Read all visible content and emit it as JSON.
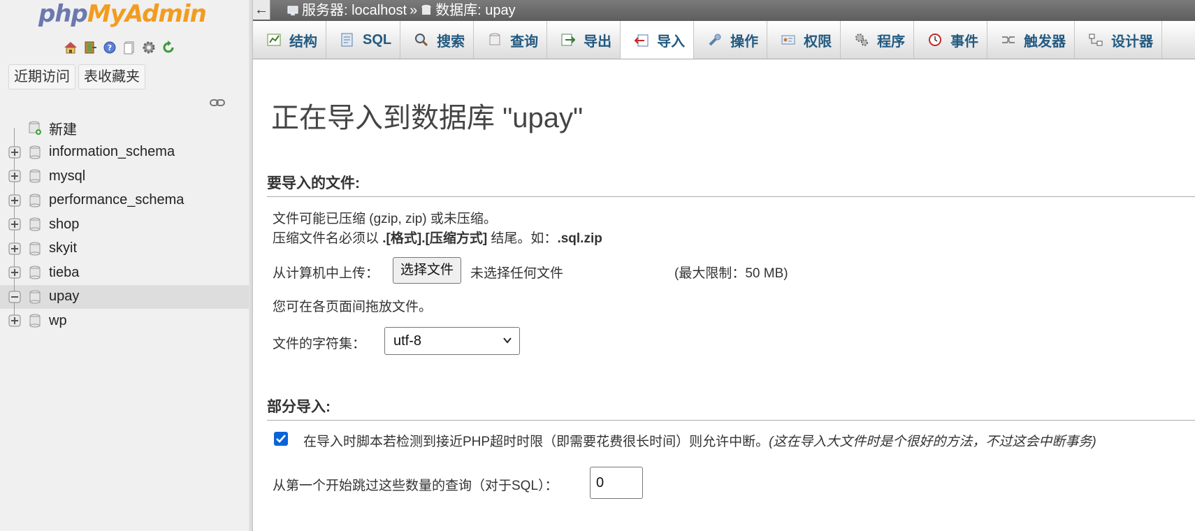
{
  "logo": {
    "php": "php",
    "my": "My",
    "admin": "Admin"
  },
  "quick_icons": [
    "home-icon",
    "exit-icon",
    "help-icon",
    "docs-icon",
    "gear-icon",
    "reload-icon"
  ],
  "recent": {
    "recent_label": "近期访问",
    "favorites_label": "表收藏夹"
  },
  "tree": {
    "new_label": "新建",
    "databases": [
      {
        "name": "information_schema",
        "active": false
      },
      {
        "name": "mysql",
        "active": false
      },
      {
        "name": "performance_schema",
        "active": false
      },
      {
        "name": "shop",
        "active": false
      },
      {
        "name": "skyit",
        "active": false
      },
      {
        "name": "tieba",
        "active": false
      },
      {
        "name": "upay",
        "active": true
      },
      {
        "name": "wp",
        "active": false
      }
    ]
  },
  "breadcrumb": {
    "back": "←",
    "server": "服务器: localhost",
    "sep": "»",
    "database": "数据库: upay"
  },
  "tabs": [
    {
      "label": "结构",
      "icon": "structure-icon",
      "active": false
    },
    {
      "label": "SQL",
      "icon": "sql-icon",
      "active": false
    },
    {
      "label": "搜索",
      "icon": "search-icon",
      "active": false
    },
    {
      "label": "查询",
      "icon": "query-icon",
      "active": false
    },
    {
      "label": "导出",
      "icon": "export-icon",
      "active": false
    },
    {
      "label": "导入",
      "icon": "import-icon",
      "active": true
    },
    {
      "label": "操作",
      "icon": "wrench-icon",
      "active": false
    },
    {
      "label": "权限",
      "icon": "privileges-icon",
      "active": false
    },
    {
      "label": "程序",
      "icon": "routines-icon",
      "active": false
    },
    {
      "label": "事件",
      "icon": "events-icon",
      "active": false
    },
    {
      "label": "触发器",
      "icon": "triggers-icon",
      "active": false
    },
    {
      "label": "设计器",
      "icon": "designer-icon",
      "active": false
    }
  ],
  "main": {
    "title": "正在导入到数据库 \"upay\"",
    "file_section": {
      "heading": "要导入的文件:",
      "line1": "文件可能已压缩 (gzip, zip) 或未压缩。",
      "line2_pre": "压缩文件名必须以 ",
      "line2_bold": ".[格式].[压缩方式]",
      "line2_mid": " 结尾。如：",
      "line2_example": ".sql.zip",
      "upload_label": "从计算机中上传：",
      "choose_button": "选择文件",
      "no_file": "未选择任何文件",
      "max_limit": "(最大限制：50 MB)",
      "drag_hint": "您可在各页面间拖放文件。",
      "charset_label": "文件的字符集：",
      "charset_value": "utf-8"
    },
    "partial_section": {
      "heading": "部分导入:",
      "allow_interrupt_checked": true,
      "allow_interrupt_text": "在导入时脚本若检测到接近PHP超时时限（即需要花费很长时间）则允许中断。",
      "allow_interrupt_note": "(这在导入大文件时是个很好的方法，不过这会中断事务)",
      "skip_label": "从第一个开始跳过这些数量的查询（对于SQL）：",
      "skip_value": "0"
    }
  },
  "colors": {
    "tab_text": "#235a81",
    "logo_blue": "#6c78af",
    "logo_orange": "#f29c1f",
    "checkbox": "#0a64d8"
  }
}
